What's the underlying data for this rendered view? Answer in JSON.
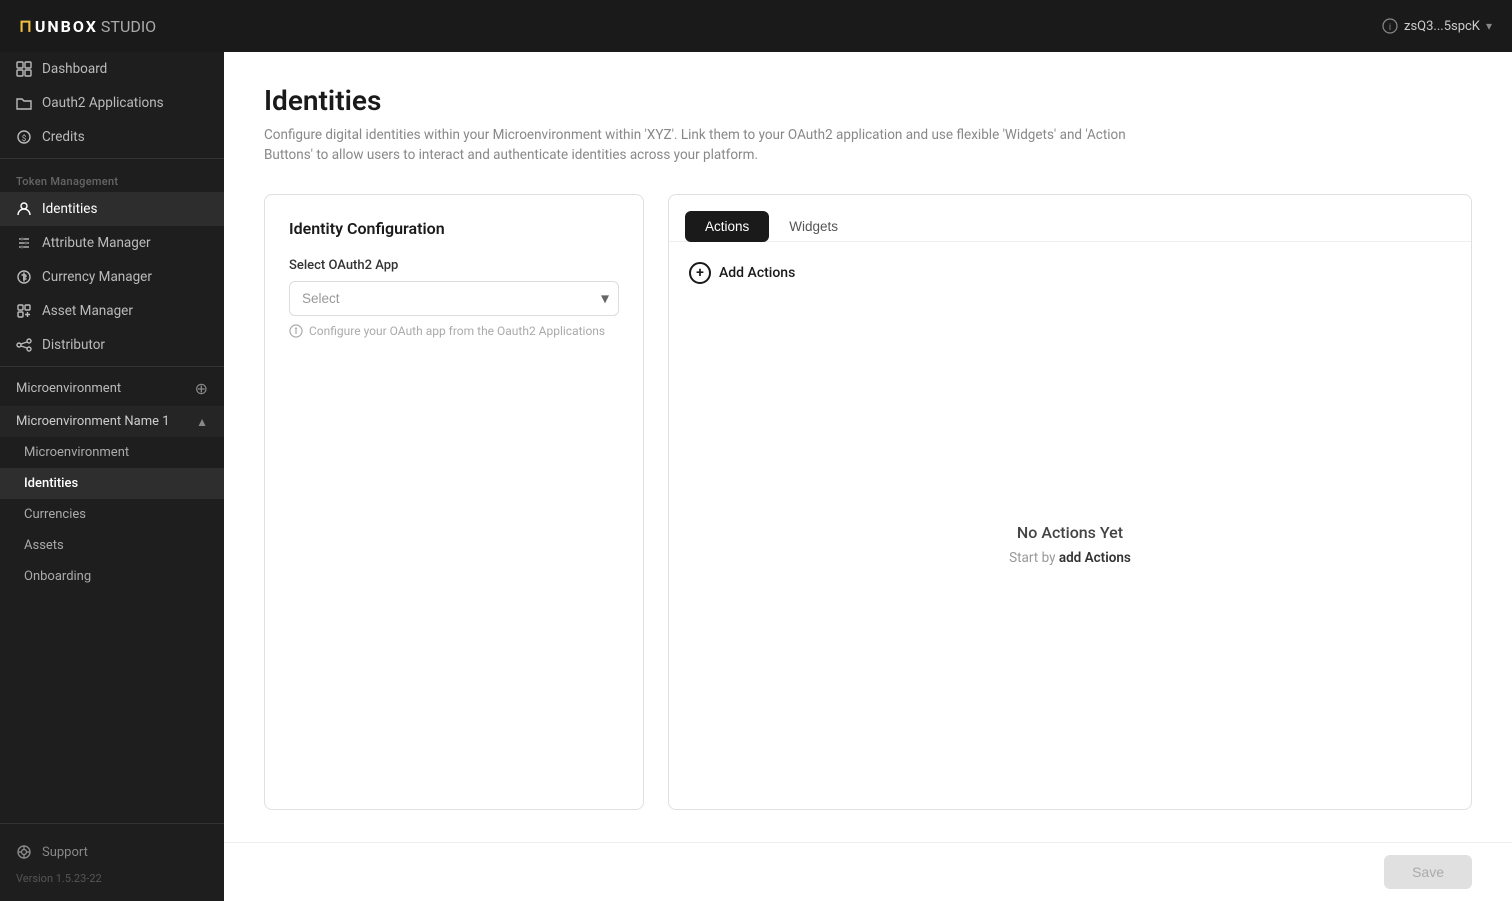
{
  "header": {
    "logo": "UNBOX STUDIO",
    "user": "zsQ3...5spcK",
    "chevron_icon": "▾"
  },
  "sidebar": {
    "nav_items": [
      {
        "id": "dashboard",
        "label": "Dashboard",
        "icon": "grid"
      },
      {
        "id": "oauth2",
        "label": "Oauth2 Applications",
        "icon": "folder"
      },
      {
        "id": "credits",
        "label": "Credits",
        "icon": "coin"
      }
    ],
    "section_label": "Token Management",
    "token_items": [
      {
        "id": "identities",
        "label": "Identities",
        "icon": "person",
        "active": true
      },
      {
        "id": "attribute-manager",
        "label": "Attribute Manager",
        "icon": "sliders"
      },
      {
        "id": "currency-manager",
        "label": "Currency Manager",
        "icon": "currency"
      },
      {
        "id": "asset-manager",
        "label": "Asset Manager",
        "icon": "asset"
      },
      {
        "id": "distributor",
        "label": "Distributor",
        "icon": "distributor"
      }
    ],
    "microenv_header": "Microenvironment",
    "microenv_name": "Microenvironment Name 1",
    "microenv_sub_items": [
      {
        "id": "microenvironment",
        "label": "Microenvironment"
      },
      {
        "id": "identities-sub",
        "label": "Identities",
        "active": true
      },
      {
        "id": "currencies",
        "label": "Currencies"
      },
      {
        "id": "assets",
        "label": "Assets"
      },
      {
        "id": "onboarding",
        "label": "Onboarding"
      }
    ],
    "footer": {
      "support_label": "Support",
      "version": "Version 1.5.23-22"
    }
  },
  "page": {
    "title": "Identities",
    "description": "Configure digital identities within your Microenvironment within 'XYZ'. Link them to your OAuth2 application and use flexible 'Widgets' and 'Action Buttons' to allow users to interact and authenticate identities across your platform."
  },
  "identity_config": {
    "title": "Identity Configuration",
    "select_label": "Select OAuth2 App",
    "select_placeholder": "Select",
    "hint_text": "Configure your OAuth app from the Oauth2 Applications"
  },
  "actions_panel": {
    "tabs": [
      {
        "id": "actions",
        "label": "Actions",
        "active": true
      },
      {
        "id": "widgets",
        "label": "Widgets"
      }
    ],
    "add_actions_label": "Add Actions",
    "empty_title": "No Actions Yet",
    "empty_subtitle_prefix": "Start by ",
    "empty_subtitle_link": "add Actions"
  },
  "bottom_bar": {
    "save_label": "Save"
  }
}
